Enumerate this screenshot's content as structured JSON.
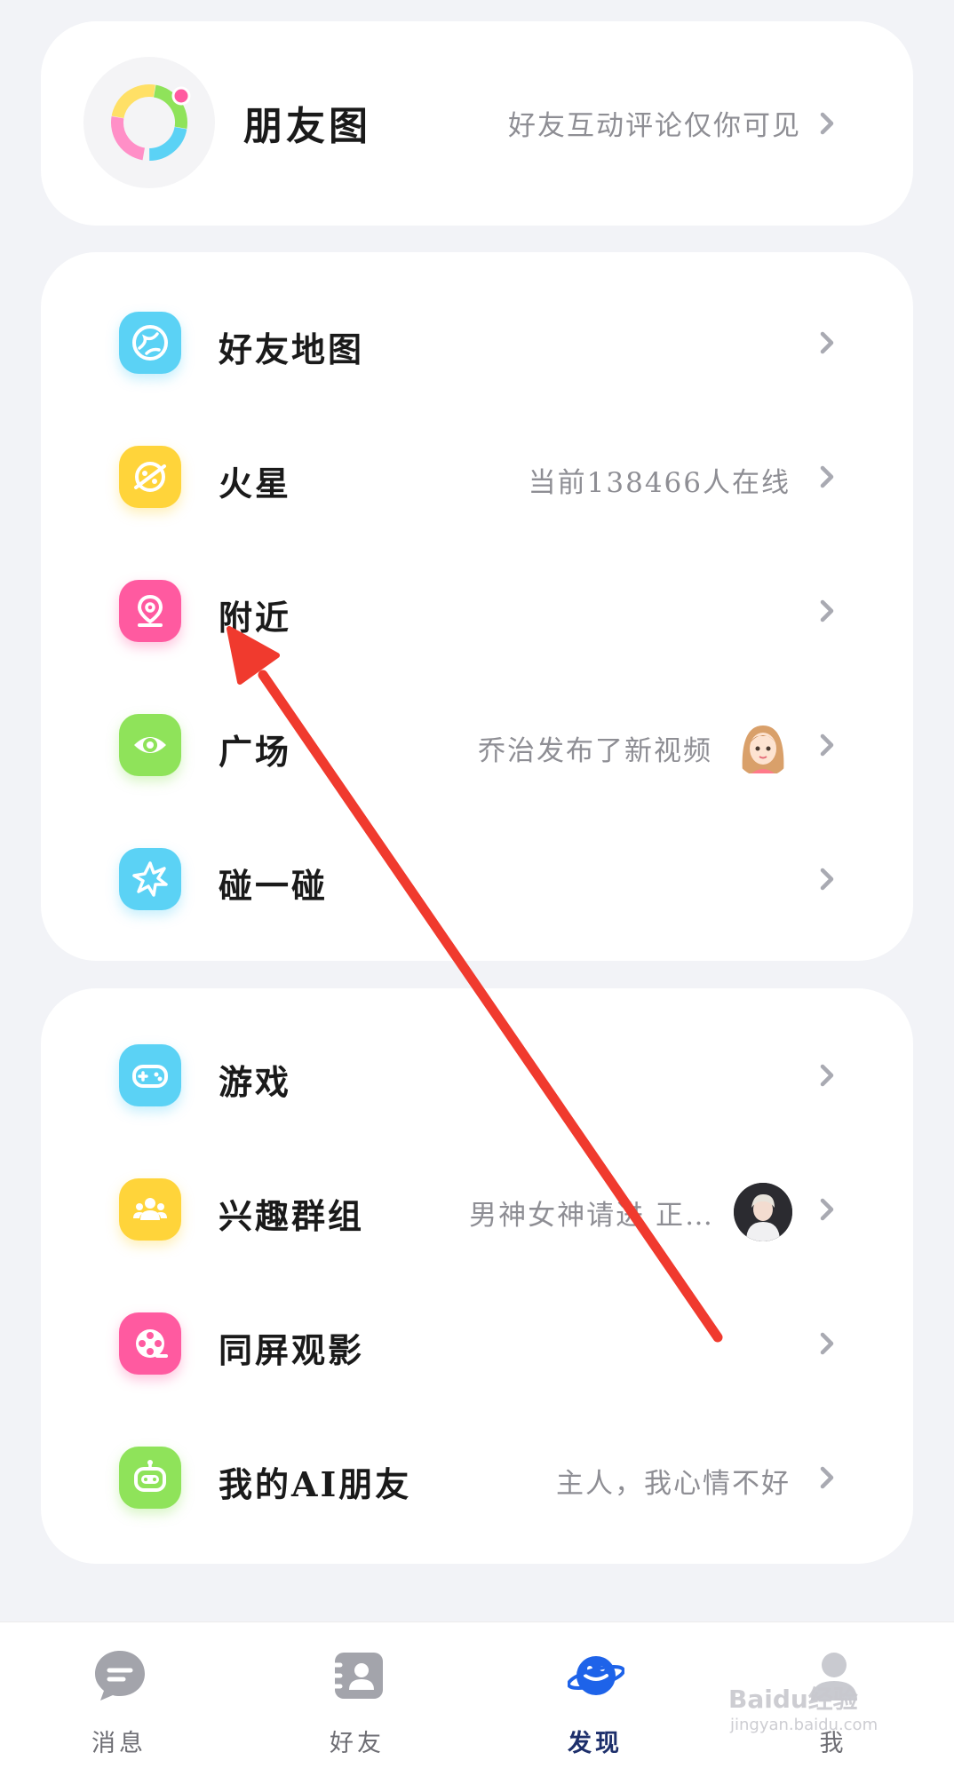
{
  "moments": {
    "title": "朋友图",
    "subtitle": "好友互动评论仅你可见"
  },
  "main_menu": [
    {
      "label": "好友地图",
      "sub": "",
      "icon": "globe-icon",
      "color": "#5bd2f5"
    },
    {
      "label": "火星",
      "sub": "当前138466人在线",
      "icon": "planet-icon",
      "color": "#ffd43a"
    },
    {
      "label": "附近",
      "sub": "",
      "icon": "location-pin-icon",
      "color": "#ff5aa0"
    },
    {
      "label": "广场",
      "sub": "乔治发布了新视频",
      "icon": "eye-icon",
      "color": "#8fe35a"
    },
    {
      "label": "碰一碰",
      "sub": "",
      "icon": "burst-icon",
      "color": "#5bd2f5"
    }
  ],
  "more_menu": [
    {
      "label": "游戏",
      "sub": "",
      "icon": "gamepad-icon",
      "color": "#5bd2f5"
    },
    {
      "label": "兴趣群组",
      "sub": "男神女神请进 正…",
      "icon": "group-icon",
      "color": "#ffd43a"
    },
    {
      "label": "同屏观影",
      "sub": "",
      "icon": "film-reel-icon",
      "color": "#ff5aa0"
    },
    {
      "label": "我的AI朋友",
      "sub": "主人，我心情不好",
      "icon": "robot-icon",
      "color": "#8fe35a"
    }
  ],
  "tabbar": {
    "tabs": [
      {
        "label": "消息",
        "icon": "message-icon",
        "active": false
      },
      {
        "label": "好友",
        "icon": "contacts-icon",
        "active": false
      },
      {
        "label": "发现",
        "icon": "planet-discover-icon",
        "active": true
      },
      {
        "label": "我",
        "icon": "person-icon",
        "active": false
      }
    ]
  },
  "watermark": {
    "text": "Baidu经验",
    "sub": "jingyan.baidu.com"
  },
  "colors": {
    "background": "#f2f3f7",
    "card": "#ffffff",
    "annotation_arrow": "#f03a2e",
    "active_tab": "#1d2f6b"
  }
}
